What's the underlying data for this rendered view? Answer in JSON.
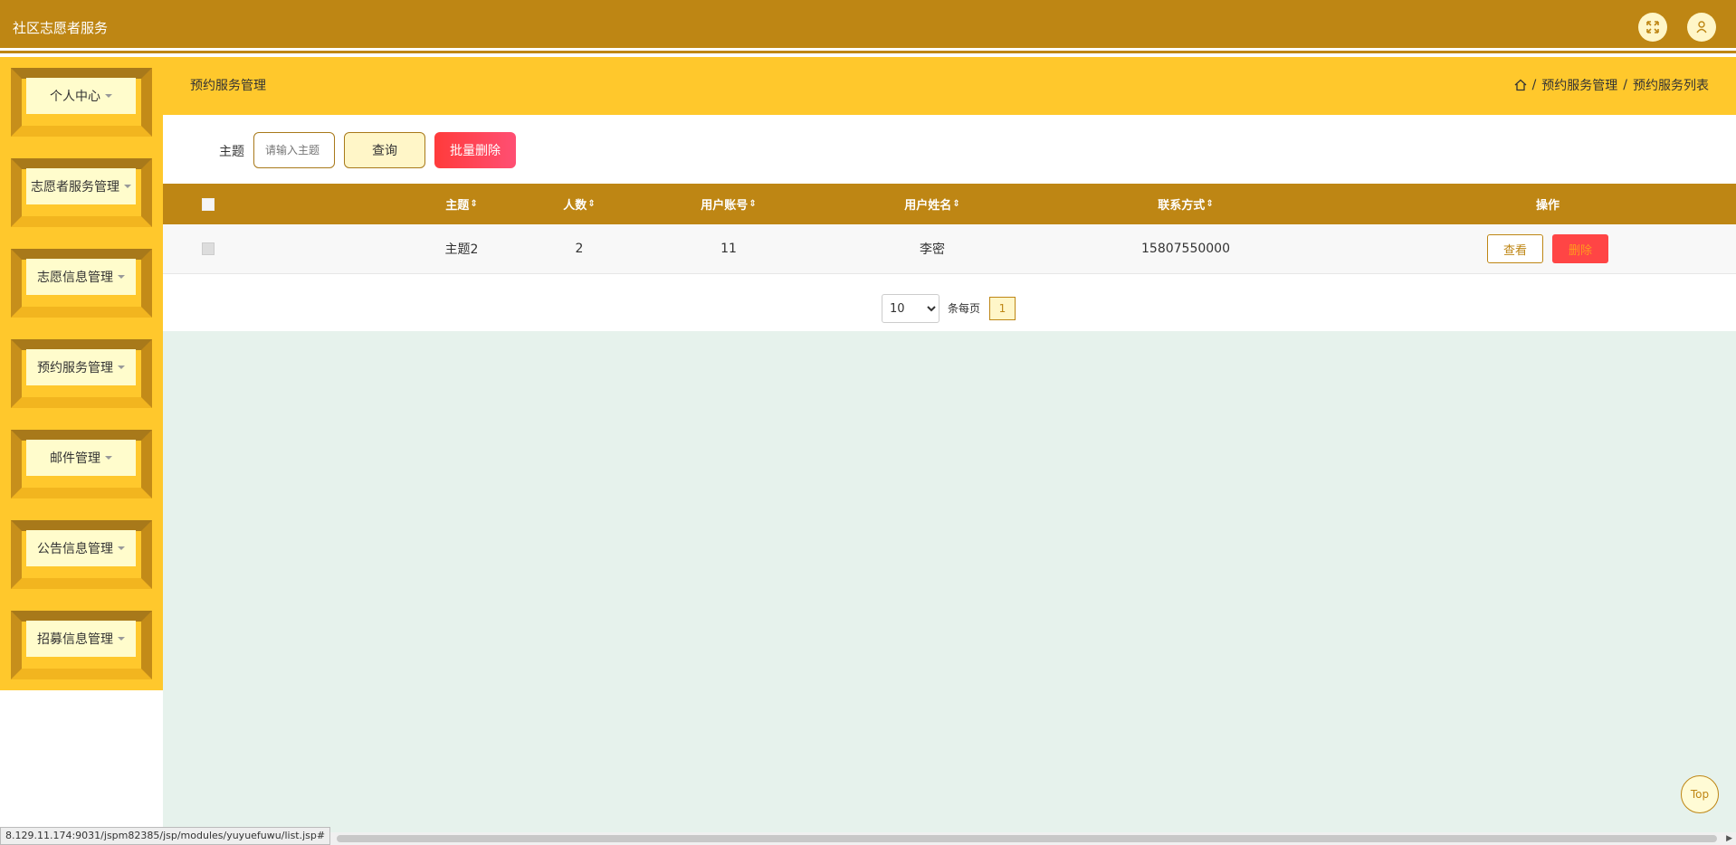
{
  "app": {
    "title": "社区志愿者服务"
  },
  "header_icons": {
    "fullscreen": "fullscreen-icon",
    "user": "user-icon"
  },
  "sidebar": {
    "items": [
      {
        "label": "个人中心"
      },
      {
        "label": "志愿者服务管理"
      },
      {
        "label": "志愿信息管理"
      },
      {
        "label": "预约服务管理"
      },
      {
        "label": "邮件管理"
      },
      {
        "label": "公告信息管理"
      },
      {
        "label": "招募信息管理"
      }
    ]
  },
  "breadcrumb": {
    "page_title": "预约服务管理",
    "items": [
      "预约服务管理",
      "预约服务列表"
    ],
    "separator": "/"
  },
  "search": {
    "label": "主题",
    "placeholder": "请输入主题",
    "query_label": "查询",
    "batch_delete_label": "批量删除"
  },
  "table": {
    "columns": [
      "主题",
      "人数",
      "用户账号",
      "用户姓名",
      "联系方式",
      "操作"
    ],
    "rows": [
      {
        "topic": "主题2",
        "count": "2",
        "account": "11",
        "name": "李密",
        "contact": "15807550000"
      }
    ],
    "view_label": "查看",
    "delete_label": "删除"
  },
  "pager": {
    "page_size": "10",
    "page_size_options": [
      "10"
    ],
    "per_page_label": "条每页",
    "current_page": "1"
  },
  "back_to_top": "Top",
  "status_url": "8.129.11.174:9031/jspm82385/jsp/modules/yuyuefuwu/list.jsp#",
  "colors": {
    "primary": "#be8614",
    "accent": "#ffc82c",
    "danger": "#ff4545"
  }
}
